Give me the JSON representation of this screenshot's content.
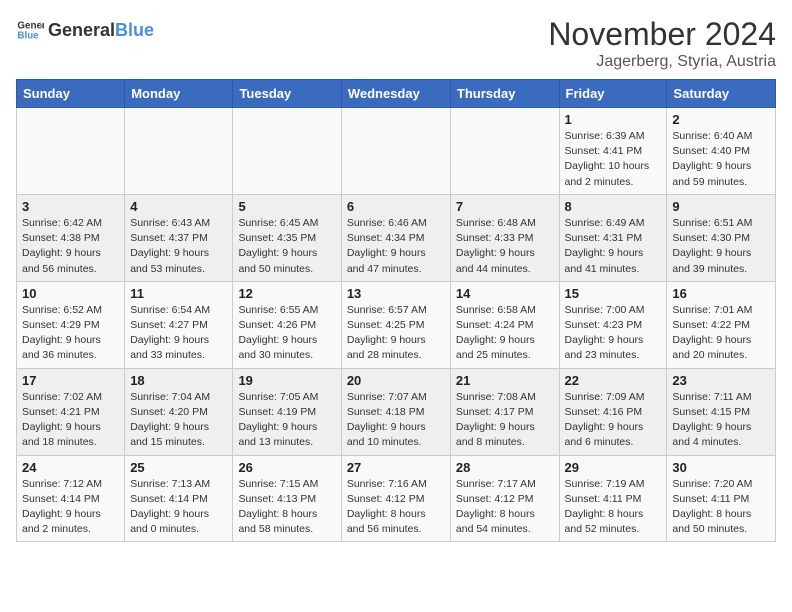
{
  "logo": {
    "general": "General",
    "blue": "Blue"
  },
  "header": {
    "month": "November 2024",
    "location": "Jagerberg, Styria, Austria"
  },
  "weekdays": [
    "Sunday",
    "Monday",
    "Tuesday",
    "Wednesday",
    "Thursday",
    "Friday",
    "Saturday"
  ],
  "weeks": [
    [
      {
        "day": "",
        "info": ""
      },
      {
        "day": "",
        "info": ""
      },
      {
        "day": "",
        "info": ""
      },
      {
        "day": "",
        "info": ""
      },
      {
        "day": "",
        "info": ""
      },
      {
        "day": "1",
        "info": "Sunrise: 6:39 AM\nSunset: 4:41 PM\nDaylight: 10 hours\nand 2 minutes."
      },
      {
        "day": "2",
        "info": "Sunrise: 6:40 AM\nSunset: 4:40 PM\nDaylight: 9 hours\nand 59 minutes."
      }
    ],
    [
      {
        "day": "3",
        "info": "Sunrise: 6:42 AM\nSunset: 4:38 PM\nDaylight: 9 hours\nand 56 minutes."
      },
      {
        "day": "4",
        "info": "Sunrise: 6:43 AM\nSunset: 4:37 PM\nDaylight: 9 hours\nand 53 minutes."
      },
      {
        "day": "5",
        "info": "Sunrise: 6:45 AM\nSunset: 4:35 PM\nDaylight: 9 hours\nand 50 minutes."
      },
      {
        "day": "6",
        "info": "Sunrise: 6:46 AM\nSunset: 4:34 PM\nDaylight: 9 hours\nand 47 minutes."
      },
      {
        "day": "7",
        "info": "Sunrise: 6:48 AM\nSunset: 4:33 PM\nDaylight: 9 hours\nand 44 minutes."
      },
      {
        "day": "8",
        "info": "Sunrise: 6:49 AM\nSunset: 4:31 PM\nDaylight: 9 hours\nand 41 minutes."
      },
      {
        "day": "9",
        "info": "Sunrise: 6:51 AM\nSunset: 4:30 PM\nDaylight: 9 hours\nand 39 minutes."
      }
    ],
    [
      {
        "day": "10",
        "info": "Sunrise: 6:52 AM\nSunset: 4:29 PM\nDaylight: 9 hours\nand 36 minutes."
      },
      {
        "day": "11",
        "info": "Sunrise: 6:54 AM\nSunset: 4:27 PM\nDaylight: 9 hours\nand 33 minutes."
      },
      {
        "day": "12",
        "info": "Sunrise: 6:55 AM\nSunset: 4:26 PM\nDaylight: 9 hours\nand 30 minutes."
      },
      {
        "day": "13",
        "info": "Sunrise: 6:57 AM\nSunset: 4:25 PM\nDaylight: 9 hours\nand 28 minutes."
      },
      {
        "day": "14",
        "info": "Sunrise: 6:58 AM\nSunset: 4:24 PM\nDaylight: 9 hours\nand 25 minutes."
      },
      {
        "day": "15",
        "info": "Sunrise: 7:00 AM\nSunset: 4:23 PM\nDaylight: 9 hours\nand 23 minutes."
      },
      {
        "day": "16",
        "info": "Sunrise: 7:01 AM\nSunset: 4:22 PM\nDaylight: 9 hours\nand 20 minutes."
      }
    ],
    [
      {
        "day": "17",
        "info": "Sunrise: 7:02 AM\nSunset: 4:21 PM\nDaylight: 9 hours\nand 18 minutes."
      },
      {
        "day": "18",
        "info": "Sunrise: 7:04 AM\nSunset: 4:20 PM\nDaylight: 9 hours\nand 15 minutes."
      },
      {
        "day": "19",
        "info": "Sunrise: 7:05 AM\nSunset: 4:19 PM\nDaylight: 9 hours\nand 13 minutes."
      },
      {
        "day": "20",
        "info": "Sunrise: 7:07 AM\nSunset: 4:18 PM\nDaylight: 9 hours\nand 10 minutes."
      },
      {
        "day": "21",
        "info": "Sunrise: 7:08 AM\nSunset: 4:17 PM\nDaylight: 9 hours\nand 8 minutes."
      },
      {
        "day": "22",
        "info": "Sunrise: 7:09 AM\nSunset: 4:16 PM\nDaylight: 9 hours\nand 6 minutes."
      },
      {
        "day": "23",
        "info": "Sunrise: 7:11 AM\nSunset: 4:15 PM\nDaylight: 9 hours\nand 4 minutes."
      }
    ],
    [
      {
        "day": "24",
        "info": "Sunrise: 7:12 AM\nSunset: 4:14 PM\nDaylight: 9 hours\nand 2 minutes."
      },
      {
        "day": "25",
        "info": "Sunrise: 7:13 AM\nSunset: 4:14 PM\nDaylight: 9 hours\nand 0 minutes."
      },
      {
        "day": "26",
        "info": "Sunrise: 7:15 AM\nSunset: 4:13 PM\nDaylight: 8 hours\nand 58 minutes."
      },
      {
        "day": "27",
        "info": "Sunrise: 7:16 AM\nSunset: 4:12 PM\nDaylight: 8 hours\nand 56 minutes."
      },
      {
        "day": "28",
        "info": "Sunrise: 7:17 AM\nSunset: 4:12 PM\nDaylight: 8 hours\nand 54 minutes."
      },
      {
        "day": "29",
        "info": "Sunrise: 7:19 AM\nSunset: 4:11 PM\nDaylight: 8 hours\nand 52 minutes."
      },
      {
        "day": "30",
        "info": "Sunrise: 7:20 AM\nSunset: 4:11 PM\nDaylight: 8 hours\nand 50 minutes."
      }
    ]
  ]
}
